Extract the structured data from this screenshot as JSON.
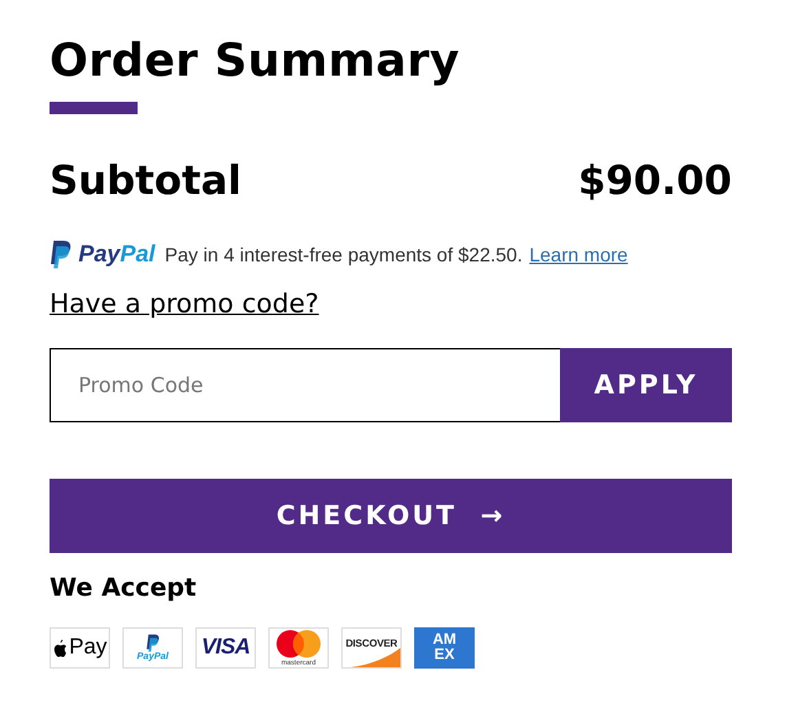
{
  "title": "Order Summary",
  "subtotal": {
    "label": "Subtotal",
    "amount": "$90.00"
  },
  "paypal": {
    "brand_a": "Pay",
    "brand_b": "Pal",
    "message": "Pay in 4 interest-free payments of $22.50.",
    "link": "Learn more"
  },
  "promo_link": "Have a promo code?",
  "promo": {
    "placeholder": "Promo Code",
    "button": "APPLY"
  },
  "checkout": {
    "label": "CHECKOUT",
    "arrow": "→"
  },
  "accept_title": "We Accept",
  "cards": [
    {
      "kind": "applepay",
      "label": "Pay"
    },
    {
      "kind": "paypal",
      "label": "PayPal"
    },
    {
      "kind": "visa",
      "label": "VISA"
    },
    {
      "kind": "mastercard",
      "label": "mastercard"
    },
    {
      "kind": "discover",
      "label": "DISCOVER"
    },
    {
      "kind": "amex",
      "label": "AM EX"
    }
  ]
}
